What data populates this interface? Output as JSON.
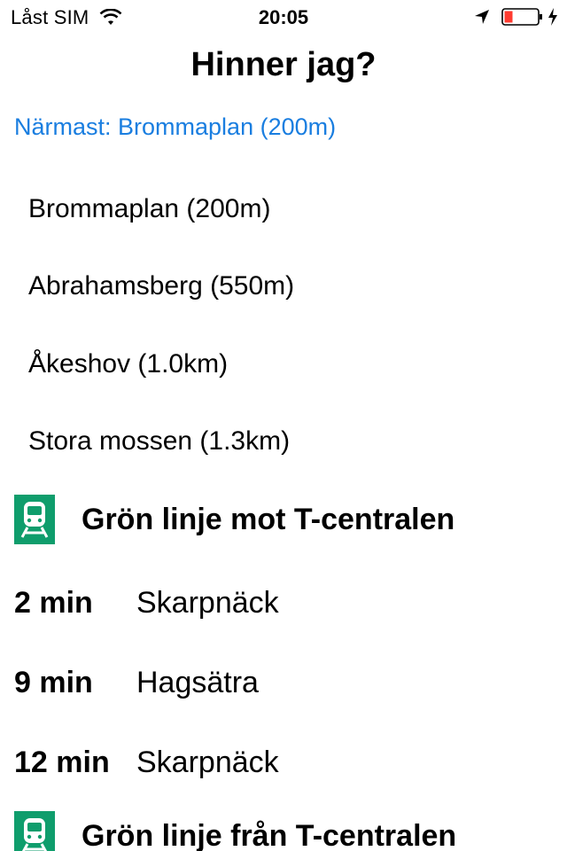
{
  "status_bar": {
    "carrier": "Låst SIM",
    "time": "20:05",
    "battery_color": "#ff3b30"
  },
  "title": "Hinner jag?",
  "nearest": "Närmast: Brommaplan (200m)",
  "stations": [
    {
      "label": "Brommaplan (200m)"
    },
    {
      "label": "Abrahamsberg (550m)"
    },
    {
      "label": "Åkeshov (1.0km)"
    },
    {
      "label": "Stora mossen (1.3km)"
    }
  ],
  "lines": [
    {
      "title": "Grön linje mot T-centralen",
      "icon": "metro-train-icon",
      "color": "#0f9d6c",
      "departures": [
        {
          "time": "2 min",
          "destination": "Skarpnäck"
        },
        {
          "time": "9 min",
          "destination": "Hagsätra"
        },
        {
          "time": "12 min",
          "destination": "Skarpnäck"
        }
      ]
    },
    {
      "title": "Grön linje från T-centralen",
      "icon": "metro-train-icon",
      "color": "#0f9d6c"
    }
  ]
}
